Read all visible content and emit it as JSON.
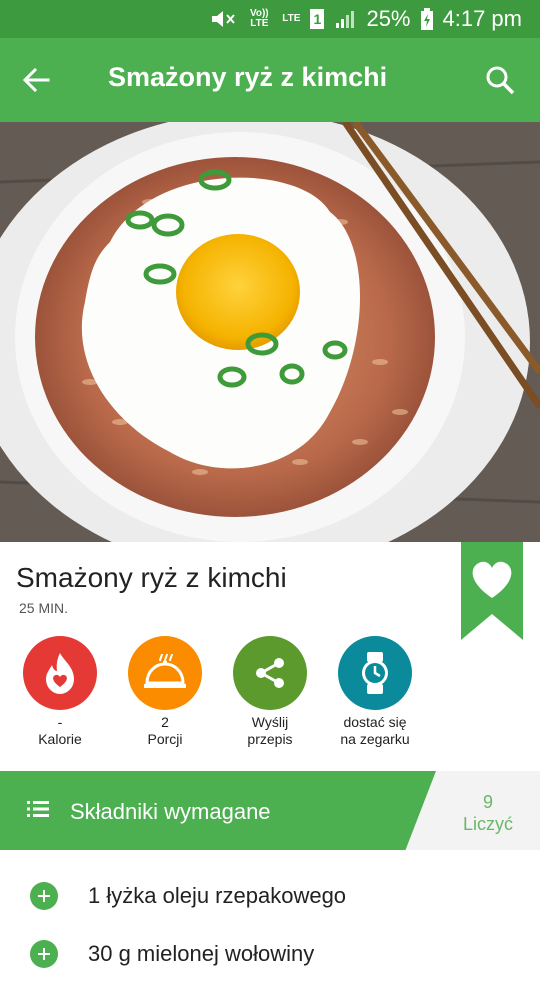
{
  "status_bar": {
    "volte": "Vo)) LTE",
    "lte": "LTE",
    "sim": "1",
    "battery": "25%",
    "time": "4:17 pm"
  },
  "app_bar": {
    "title": "Smażony ryż z kimchi",
    "back_icon": "arrow-left-icon",
    "search_icon": "search-icon"
  },
  "recipe": {
    "title": "Smażony ryż z kimchi",
    "time": "25 MIN.",
    "bookmark_icon": "heart-icon"
  },
  "actions": [
    {
      "value": "-",
      "label": "Kalorie",
      "icon": "flame-heart-icon",
      "color": "#e53935"
    },
    {
      "value": "2",
      "label": "Porcji",
      "icon": "serving-dish-icon",
      "color": "#fb8c00"
    },
    {
      "value": "Wyślij",
      "label": "przepis",
      "icon": "share-icon",
      "color": "#5c9a2e"
    },
    {
      "value": "dostać się",
      "label": "na zegarku",
      "icon": "watch-icon",
      "color": "#0a8a9a"
    }
  ],
  "ingredients_header": {
    "title": "Składniki wymagane",
    "count_value": "9",
    "count_label": "Liczyć"
  },
  "ingredients": [
    {
      "text": "1 łyżka oleju rzepakowego"
    },
    {
      "text": "30 g mielonej wołowiny"
    }
  ],
  "colors": {
    "primary": "#4caf50",
    "status_bar": "#3d9a3f"
  }
}
